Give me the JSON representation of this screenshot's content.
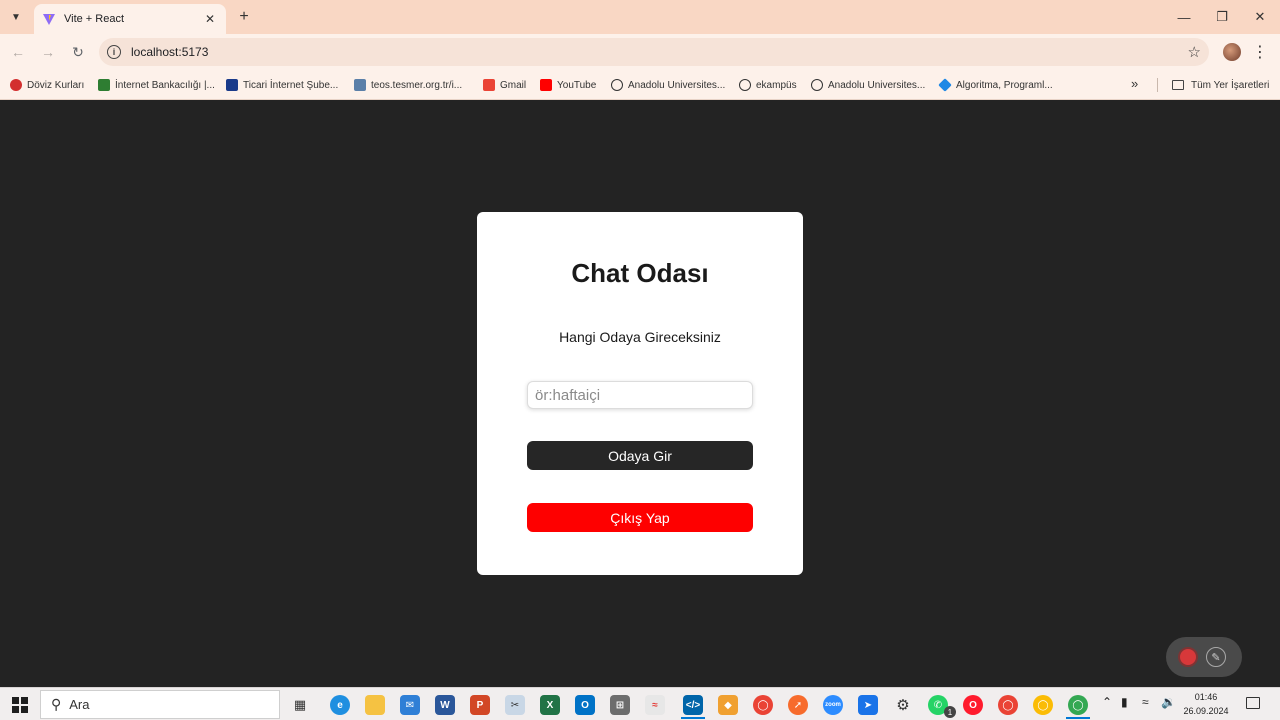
{
  "browser": {
    "tab_title": "Vite + React",
    "url": "localhost:5173",
    "bookmarks": [
      {
        "label": "Döviz Kurları",
        "icon": "currency-icon",
        "color": "#d32f2f"
      },
      {
        "label": "İnternet Bankacılığı |...",
        "icon": "bank-icon",
        "color": "#2e7d32"
      },
      {
        "label": "Ticari İnternet Şube...",
        "icon": "isbank-icon",
        "color": "#1a3a8a"
      },
      {
        "label": "teos.tesmer.org.tr/i...",
        "icon": "teos-icon",
        "color": "#5b7fa8"
      },
      {
        "label": "Gmail",
        "icon": "gmail-icon",
        "color": "#ea4335"
      },
      {
        "label": "YouTube",
        "icon": "youtube-icon",
        "color": "#ff0000"
      },
      {
        "label": "Anadolu Universites...",
        "icon": "anadolu-icon",
        "color": "#333333"
      },
      {
        "label": "ekampüs",
        "icon": "anadolu-icon",
        "color": "#333333"
      },
      {
        "label": "Anadolu Universites...",
        "icon": "anadolu-icon",
        "color": "#333333"
      },
      {
        "label": "Algoritma, Programl...",
        "icon": "diamond-icon",
        "color": "#1e88e5"
      }
    ],
    "all_bookmarks_label": "Tüm Yer İşaretleri"
  },
  "page": {
    "title": "Chat Odası",
    "subtitle": "Hangi Odaya Gireceksiniz",
    "room_input": {
      "placeholder": "ör:haftaiçi",
      "value": ""
    },
    "enter_button": "Odaya Gir",
    "exit_button": "Çıkış Yap",
    "colors": {
      "background": "#232323",
      "card": "#ffffff",
      "enter": "#262626",
      "exit": "#fe0000"
    }
  },
  "taskbar": {
    "search_label": "Ara",
    "time": "01:46",
    "date": "26.09.2024",
    "whatsapp_badge": "1"
  }
}
